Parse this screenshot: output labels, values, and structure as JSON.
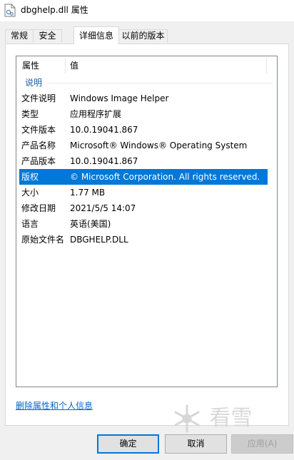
{
  "window": {
    "title": "dbghelp.dll 属性"
  },
  "tabs": [
    {
      "label": "常规"
    },
    {
      "label": "安全"
    },
    {
      "label": "详细信息"
    },
    {
      "label": "以前的版本"
    }
  ],
  "active_tab": "详细信息",
  "list": {
    "columns": {
      "property": "属性",
      "value": "值"
    },
    "group": "说明",
    "rows": [
      {
        "name": "文件说明",
        "value": "Windows Image Helper"
      },
      {
        "name": "类型",
        "value": "应用程序扩展"
      },
      {
        "name": "文件版本",
        "value": "10.0.19041.867"
      },
      {
        "name": "产品名称",
        "value": "Microsoft® Windows® Operating System"
      },
      {
        "name": "产品版本",
        "value": "10.0.19041.867"
      },
      {
        "name": "版权",
        "value": "© Microsoft Corporation. All rights reserved."
      },
      {
        "name": "大小",
        "value": "1.77 MB"
      },
      {
        "name": "修改日期",
        "value": "2021/5/5 14:07"
      },
      {
        "name": "语言",
        "value": "英语(美国)"
      },
      {
        "name": "原始文件名",
        "value": "DBGHELP.DLL"
      }
    ],
    "selected_row": "版权"
  },
  "remove_link": "删除属性和个人信息",
  "watermark": "看雪",
  "buttons": {
    "ok": "确定",
    "cancel": "取消",
    "apply": "应用(A)"
  },
  "colors": {
    "selection": "#0078d7",
    "link": "#0066cc",
    "group_label": "#1e5aa8"
  }
}
